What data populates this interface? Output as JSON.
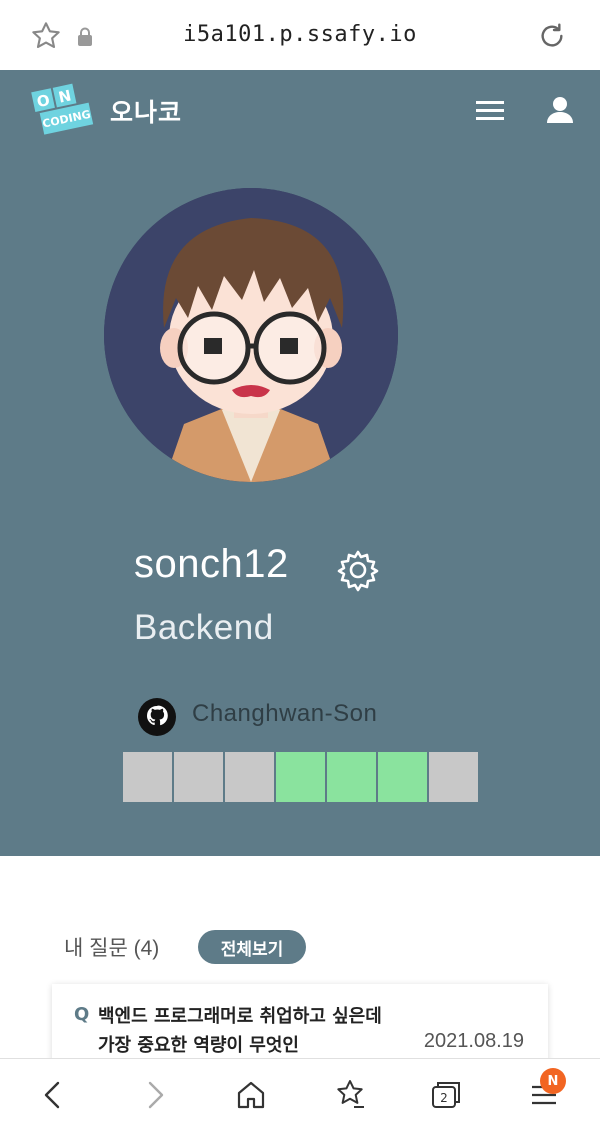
{
  "browser": {
    "url": "i5a101.p.ssafy.io",
    "tab_count": "2",
    "menu_badge": "N"
  },
  "header": {
    "logo_top": "ON",
    "logo_bottom": "CODING",
    "brand": "오나코"
  },
  "profile": {
    "username": "sonch12",
    "role": "Backend",
    "github": "Changhwan-Son",
    "grass": [
      0,
      0,
      0,
      1,
      1,
      1,
      0
    ],
    "grass_colors": {
      "empty": "#c8c8c8",
      "active": "#8ae39e"
    }
  },
  "questions": {
    "title": "내 질문 (4)",
    "view_all": "전체보기",
    "items": [
      {
        "mark": "Q",
        "text": "백엔드 프로그래머로 취업하고 싶은데 가장 중요한 역량이 무엇인",
        "date": "2021.08.19"
      }
    ]
  },
  "colors": {
    "primary": "#5e7b88"
  }
}
